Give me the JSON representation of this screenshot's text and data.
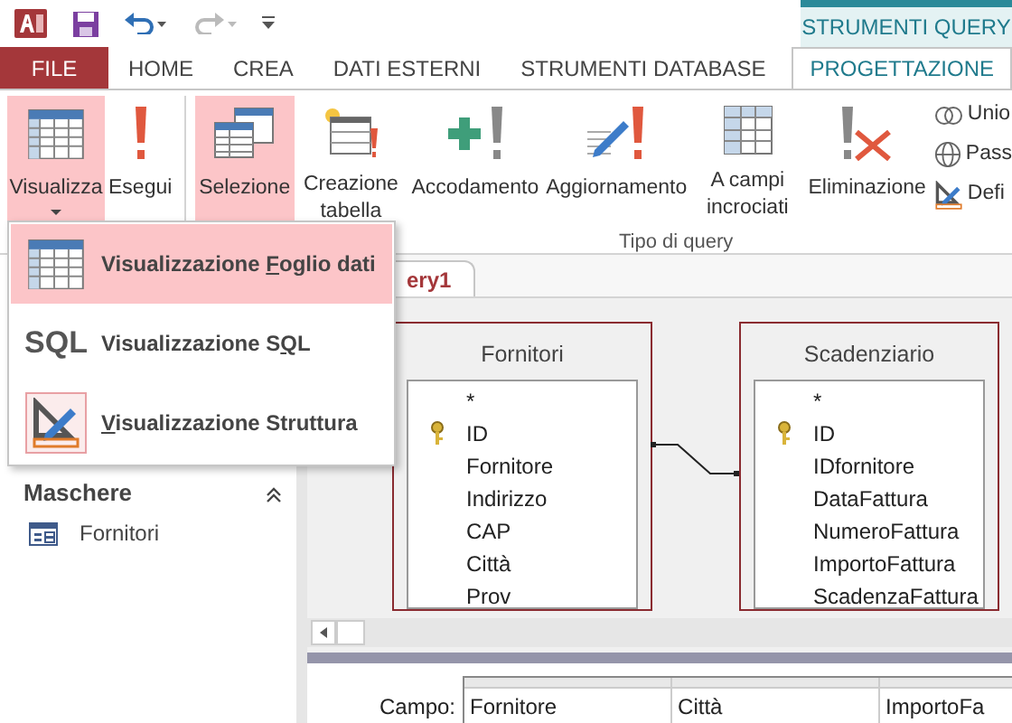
{
  "contextual_group": "STRUMENTI QUERY",
  "tabs": [
    {
      "label": "FILE",
      "kind": "file",
      "selected": false
    },
    {
      "label": "HOME",
      "kind": "normal",
      "selected": false
    },
    {
      "label": "CREA",
      "kind": "normal",
      "selected": false
    },
    {
      "label": "DATI ESTERNI",
      "kind": "normal",
      "selected": false
    },
    {
      "label": "STRUMENTI DATABASE",
      "kind": "normal",
      "selected": false
    },
    {
      "label": "PROGETTAZIONE",
      "kind": "contextual",
      "selected": true
    }
  ],
  "ribbon": {
    "results": [
      {
        "label": "Visualizza",
        "kind": "datasheet",
        "dropdown": true,
        "selected": true
      },
      {
        "label": "Esegui",
        "kind": "run",
        "dropdown": false,
        "selected": false
      }
    ],
    "query_type": {
      "label": "Tipo di query",
      "buttons": [
        {
          "label": "Selezione",
          "kind": "select",
          "selected": true
        },
        {
          "label": "Creazione tabella",
          "kind": "make-table",
          "selected": false
        },
        {
          "label": "Accodamento",
          "kind": "append",
          "selected": false
        },
        {
          "label": "Aggiornamento",
          "kind": "update",
          "selected": false
        },
        {
          "label": "A campi incrociati",
          "kind": "crosstab",
          "selected": false
        },
        {
          "label": "Eliminazione",
          "kind": "delete",
          "selected": false
        }
      ],
      "small_buttons": [
        {
          "label": "Unio",
          "kind": "union"
        },
        {
          "label": "Pass",
          "kind": "globe"
        },
        {
          "label": "Defi",
          "kind": "design"
        }
      ]
    }
  },
  "view_menu": [
    {
      "before": "Visualizzazione ",
      "key": "F",
      "after": "oglio dati",
      "kind": "datasheet",
      "selected": true
    },
    {
      "before": "Visualizzazione S",
      "key": "Q",
      "after": "L",
      "kind": "sql",
      "icon_text": "SQL",
      "selected": false
    },
    {
      "key": "V",
      "after": "isualizzazione Struttura",
      "kind": "design",
      "selected": false
    }
  ],
  "nav_pane": {
    "sections": [
      {
        "title": "Maschere",
        "expanded": true,
        "items": [
          "Fornitori"
        ]
      }
    ]
  },
  "document_tab": "ery1",
  "tables": [
    {
      "title": "Fornitori",
      "fields": [
        {
          "name": "*",
          "key": false
        },
        {
          "name": "ID",
          "key": true
        },
        {
          "name": "Fornitore",
          "key": false
        },
        {
          "name": "Indirizzo",
          "key": false
        },
        {
          "name": "CAP",
          "key": false
        },
        {
          "name": "Città",
          "key": false
        },
        {
          "name": "Prov",
          "key": false
        }
      ]
    },
    {
      "title": "Scadenziario",
      "fields": [
        {
          "name": "*",
          "key": false
        },
        {
          "name": "ID",
          "key": true
        },
        {
          "name": "IDfornitore",
          "key": false
        },
        {
          "name": "DataFattura",
          "key": false
        },
        {
          "name": "NumeroFattura",
          "key": false
        },
        {
          "name": "ImportoFattura",
          "key": false
        },
        {
          "name": "ScadenzaFattura",
          "key": false
        }
      ]
    }
  ],
  "grid": {
    "row_label": "Campo:",
    "columns": [
      "Fornitore",
      "Città",
      "ImportoFa"
    ]
  }
}
